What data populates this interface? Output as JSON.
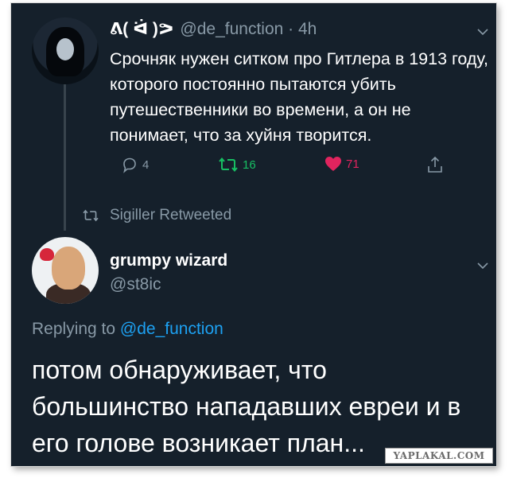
{
  "colors": {
    "background": "#15202b",
    "text_primary": "#ffffff",
    "text_secondary": "#8899a6",
    "link": "#1da1f2",
    "retweet_active": "#17bf63",
    "like_active": "#e0245e",
    "thread_line": "#38444d"
  },
  "original_tweet": {
    "author_name": "ᕕ( ᐛ )ᕗ",
    "author_meta": "@de_function · 4h",
    "text": "Срочняк нужен ситком про Гитлера в 1913 году, которого постоянно пытаются убить путешественники во времени, а он не понимает, что за хуйня творится.",
    "actions": {
      "reply_icon": "reply-icon",
      "reply_count": "4",
      "retweet_icon": "retweet-icon",
      "retweet_count": "16",
      "like_icon": "heart-icon",
      "like_count": "71",
      "share_icon": "share-icon"
    }
  },
  "retweeted_by": {
    "icon": "retweet-icon",
    "text": "Sigiller Retweeted"
  },
  "reply_tweet": {
    "author_name": "grumpy wizard",
    "author_handle": "@st8ic",
    "replying_prefix": "Replying to",
    "replying_mention": "@de_function",
    "text": "потом обнаруживает, что большинство нападавших евреи и в его голове возникает план..."
  },
  "watermark": {
    "text": "YAPLAKAL.COM"
  }
}
